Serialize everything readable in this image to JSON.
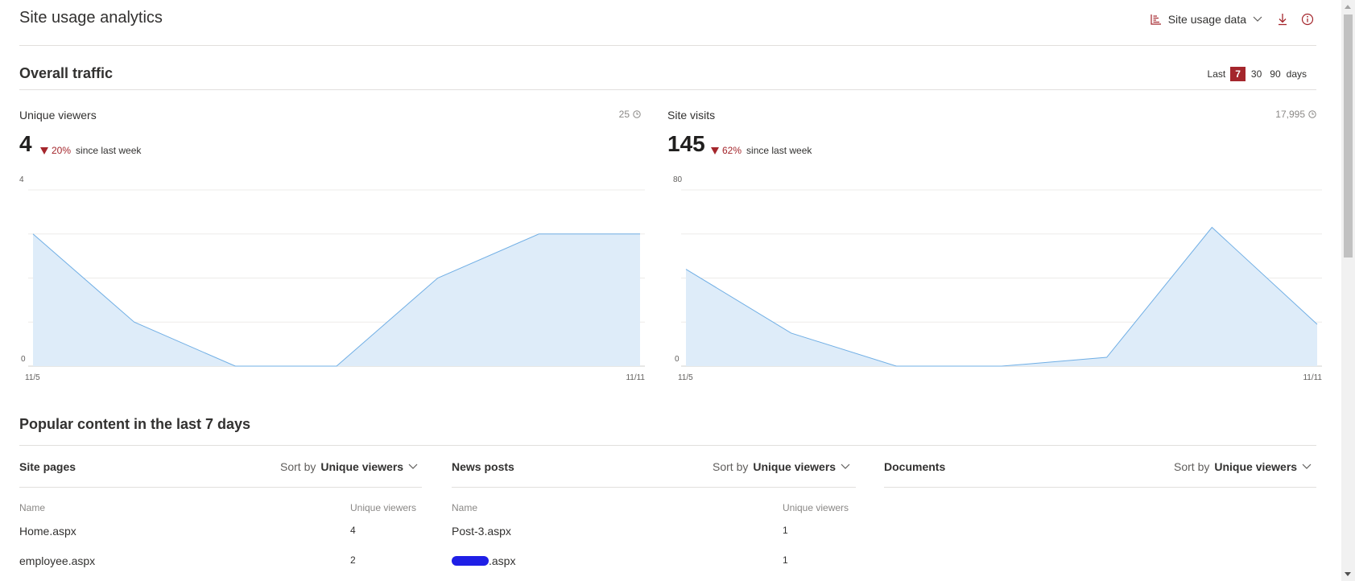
{
  "header": {
    "title": "Site usage analytics",
    "site_usage_label": "Site usage data"
  },
  "overall_traffic": {
    "title": "Overall traffic",
    "range": {
      "prefix": "Last",
      "options": [
        "7",
        "30",
        "90"
      ],
      "selected": "7",
      "suffix": "days"
    }
  },
  "metrics": [
    {
      "label": "Unique viewers",
      "total": "25",
      "value": "4",
      "change": "20%",
      "since": "since last week"
    },
    {
      "label": "Site visits",
      "total": "17,995",
      "value": "145",
      "change": "62%",
      "since": "since last week"
    }
  ],
  "chart_data": [
    {
      "type": "area",
      "title": "Unique viewers",
      "x": [
        "11/5",
        "11/6",
        "11/7",
        "11/8",
        "11/9",
        "11/10",
        "11/11"
      ],
      "x_tick_labels": [
        "11/5",
        "11/11"
      ],
      "values": [
        3,
        1,
        0,
        0,
        2,
        3,
        3
      ],
      "ylim": [
        0,
        4
      ],
      "y_tick_labels": [
        "4",
        "0"
      ],
      "grid": true,
      "fill_color": "#deecf9",
      "line_color": "#71afe5"
    },
    {
      "type": "area",
      "title": "Site visits",
      "x": [
        "11/5",
        "11/6",
        "11/7",
        "11/8",
        "11/9",
        "11/10",
        "11/11"
      ],
      "x_tick_labels": [
        "11/5",
        "11/11"
      ],
      "values": [
        44,
        15,
        0,
        0,
        4,
        63,
        19
      ],
      "ylim": [
        0,
        80
      ],
      "y_tick_labels": [
        "80",
        "0"
      ],
      "grid": true,
      "fill_color": "#deecf9",
      "line_color": "#71afe5"
    }
  ],
  "popular": {
    "title": "Popular content in the last 7 days",
    "columns": [
      {
        "title": "Site pages",
        "sort_label": "Sort by",
        "sort_value": "Unique viewers",
        "headers": [
          "Name",
          "Unique viewers"
        ],
        "rows": [
          {
            "name": "Home.aspx",
            "count": "4"
          },
          {
            "name": "employee.aspx",
            "count": "2"
          }
        ]
      },
      {
        "title": "News posts",
        "sort_label": "Sort by",
        "sort_value": "Unique viewers",
        "headers": [
          "Name",
          "Unique viewers"
        ],
        "rows": [
          {
            "name": "Post-3.aspx",
            "count": "1"
          },
          {
            "name": ".aspx",
            "count": "1"
          }
        ]
      },
      {
        "title": "Documents",
        "sort_label": "Sort by",
        "sort_value": "Unique viewers"
      }
    ]
  },
  "colors": {
    "accent": "#a4262c",
    "text": "#323130",
    "muted": "#8a8886",
    "divider": "#e1dfdd"
  }
}
